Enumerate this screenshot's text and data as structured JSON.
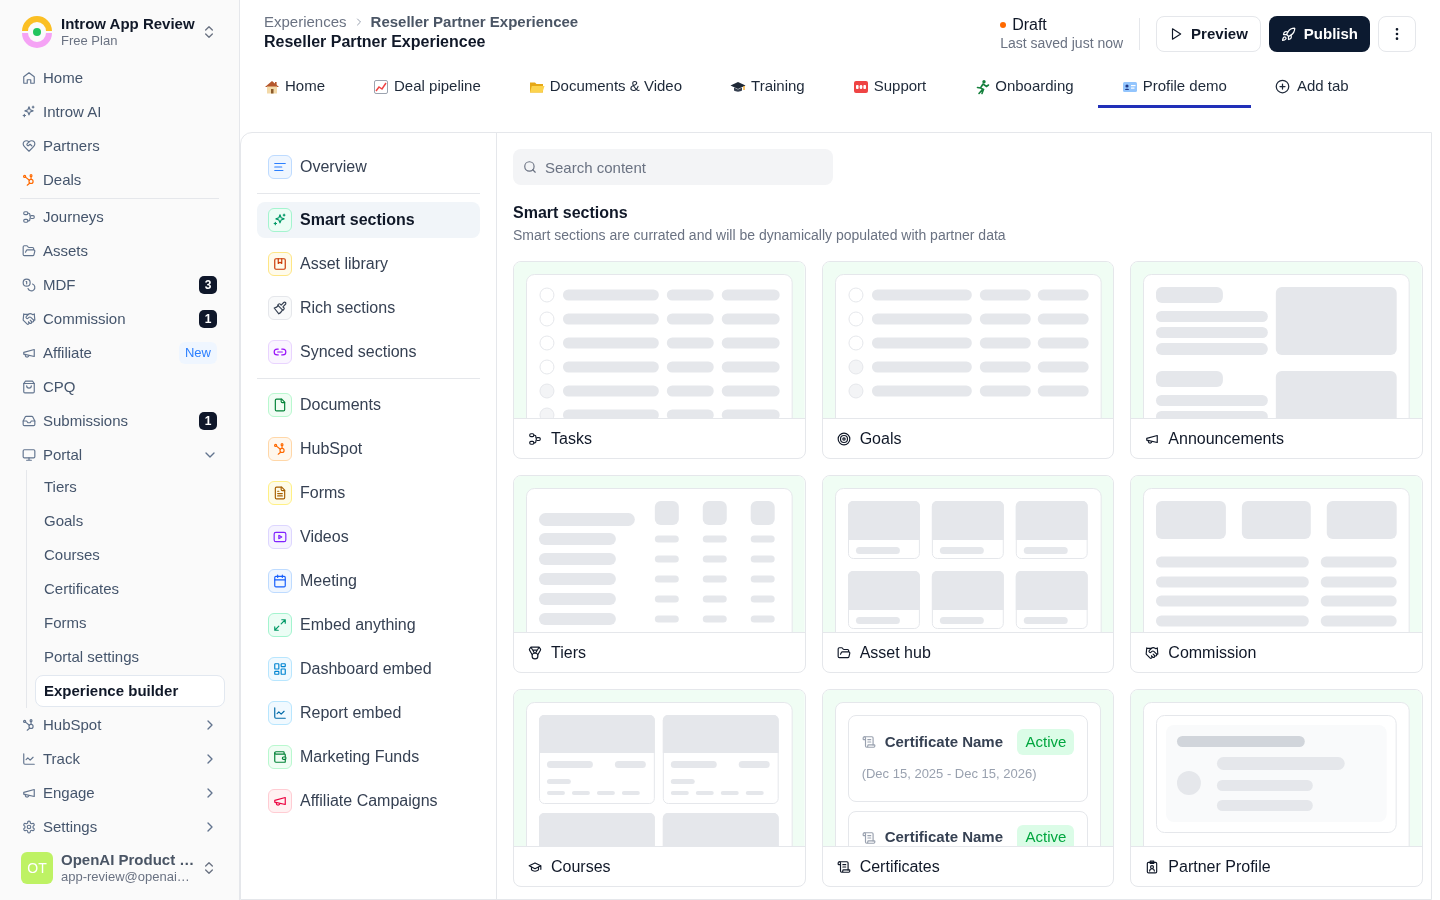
{
  "workspace": {
    "name": "Introw App Review",
    "plan": "Free Plan"
  },
  "sidebar": {
    "groups": [
      {
        "items": [
          {
            "label": "Home",
            "selected": false
          },
          {
            "label": "Introw AI",
            "selected": false
          },
          {
            "label": "Partners",
            "selected": false
          },
          {
            "label": "Deals",
            "selected": false
          }
        ]
      },
      {
        "items": [
          {
            "label": "Journeys",
            "selected": false
          },
          {
            "label": "Assets",
            "selected": false
          },
          {
            "label": "MDF",
            "selected": false,
            "badge": {
              "text": "3",
              "kind": "count"
            }
          },
          {
            "label": "Commission",
            "selected": false,
            "badge": {
              "text": "1",
              "kind": "count"
            }
          },
          {
            "label": "Affiliate",
            "selected": false,
            "badge": {
              "text": "New",
              "kind": "new"
            }
          },
          {
            "label": "CPQ",
            "selected": false
          },
          {
            "label": "Submissions",
            "selected": false,
            "badge": {
              "text": "1",
              "kind": "count"
            }
          },
          {
            "label": "Portal",
            "selected": false,
            "expanded": true,
            "children": [
              {
                "label": "Tiers",
                "selected": false
              },
              {
                "label": "Goals",
                "selected": false
              },
              {
                "label": "Courses",
                "selected": false
              },
              {
                "label": "Certificates",
                "selected": false
              },
              {
                "label": "Forms",
                "selected": false
              },
              {
                "label": "Portal settings",
                "selected": false
              },
              {
                "label": "Experience builder",
                "selected": true
              }
            ]
          },
          {
            "label": "HubSpot",
            "selected": false,
            "expanded": false
          },
          {
            "label": "Track",
            "selected": false,
            "expanded": false
          },
          {
            "label": "Engage",
            "selected": false,
            "expanded": false
          },
          {
            "label": "Settings",
            "selected": false,
            "expanded": false
          }
        ]
      }
    ]
  },
  "user": {
    "initials": "OT",
    "name": "OpenAI Product …",
    "email": "app-review@openai…"
  },
  "header": {
    "breadcrumb": [
      "Experiences",
      "Reseller Partner Experiencee"
    ],
    "title": "Reseller Partner Experiencee",
    "status": {
      "label": "Draft",
      "saved": "Last saved just now"
    },
    "preview": "Preview",
    "publish": "Publish"
  },
  "tabs": [
    {
      "label": "Home",
      "selected": false
    },
    {
      "label": "Deal pipeline",
      "selected": false
    },
    {
      "label": "Documents & Video",
      "selected": false
    },
    {
      "label": "Training",
      "selected": false
    },
    {
      "label": "Support",
      "selected": false
    },
    {
      "label": "Onboarding",
      "selected": false
    },
    {
      "label": "Profile demo",
      "selected": true
    }
  ],
  "add_tab": "Add tab",
  "section_nav": {
    "groups": [
      {
        "items": [
          {
            "label": "Overview",
            "selected": false
          }
        ]
      },
      {
        "items": [
          {
            "label": "Smart sections",
            "selected": true
          },
          {
            "label": "Asset library",
            "selected": false
          },
          {
            "label": "Rich sections",
            "selected": false
          },
          {
            "label": "Synced sections",
            "selected": false
          }
        ]
      },
      {
        "items": [
          {
            "label": "Documents",
            "selected": false
          },
          {
            "label": "HubSpot",
            "selected": false
          },
          {
            "label": "Forms",
            "selected": false
          },
          {
            "label": "Videos",
            "selected": false
          },
          {
            "label": "Meeting",
            "selected": false
          },
          {
            "label": "Embed anything",
            "selected": false
          },
          {
            "label": "Dashboard embed",
            "selected": false
          },
          {
            "label": "Report embed",
            "selected": false
          },
          {
            "label": "Marketing Funds",
            "selected": false
          },
          {
            "label": "Affiliate Campaigns",
            "selected": false
          }
        ]
      }
    ]
  },
  "content": {
    "search": {
      "placeholder": "Search content"
    },
    "heading": "Smart sections",
    "description": "Smart sections are currated and will be dynamically populated with partner data",
    "card_rows": [
      {
        "cards": [
          {
            "title": "Tasks",
            "kind": "tasks"
          },
          {
            "title": "Goals",
            "kind": "goals"
          },
          {
            "title": "Announcements",
            "kind": "announcements"
          }
        ]
      },
      {
        "cards": [
          {
            "title": "Tiers",
            "kind": "tiers"
          },
          {
            "title": "Asset hub",
            "kind": "asset_hub"
          },
          {
            "title": "Commission",
            "kind": "commission"
          }
        ]
      },
      {
        "cards": [
          {
            "title": "Courses",
            "kind": "courses"
          },
          {
            "title": "Certificates",
            "kind": "certificates",
            "certificates": [
              {
                "name": "Certificate Name",
                "status": "Active",
                "dates": "(Dec 15, 2025 - Dec 15, 2026)"
              },
              {
                "name": "Certificate Name",
                "status": "Active"
              }
            ]
          },
          {
            "title": "Partner Profile",
            "kind": "partner_profile"
          }
        ]
      }
    ]
  }
}
